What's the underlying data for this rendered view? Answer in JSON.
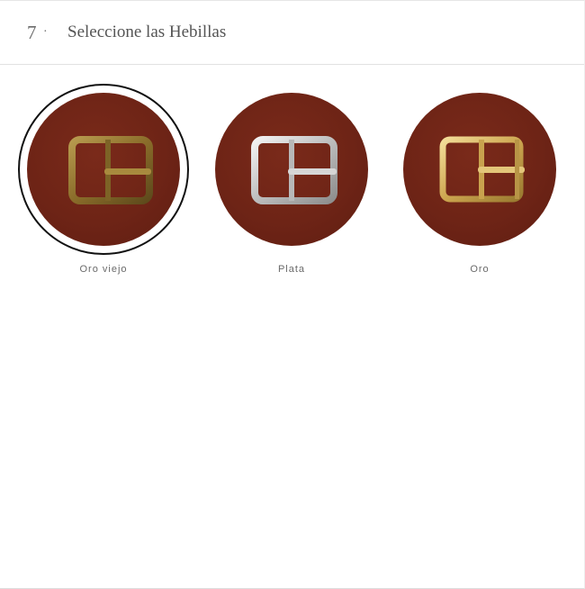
{
  "header": {
    "step_number": "7",
    "step_separator": "·",
    "title": "Seleccione las Hebillas"
  },
  "buckles": [
    {
      "label": "Oro viejo",
      "selected": true,
      "icon": "antique-gold-buckle-icon"
    },
    {
      "label": "Plata",
      "selected": false,
      "icon": "silver-buckle-icon"
    },
    {
      "label": "Oro",
      "selected": false,
      "icon": "gold-buckle-icon"
    }
  ],
  "colors": {
    "leather": "#6e2416",
    "antique_gold": "#9a7a32",
    "silver": "#c9c9c9",
    "gold": "#d8b765",
    "selected_ring": "#111111"
  }
}
